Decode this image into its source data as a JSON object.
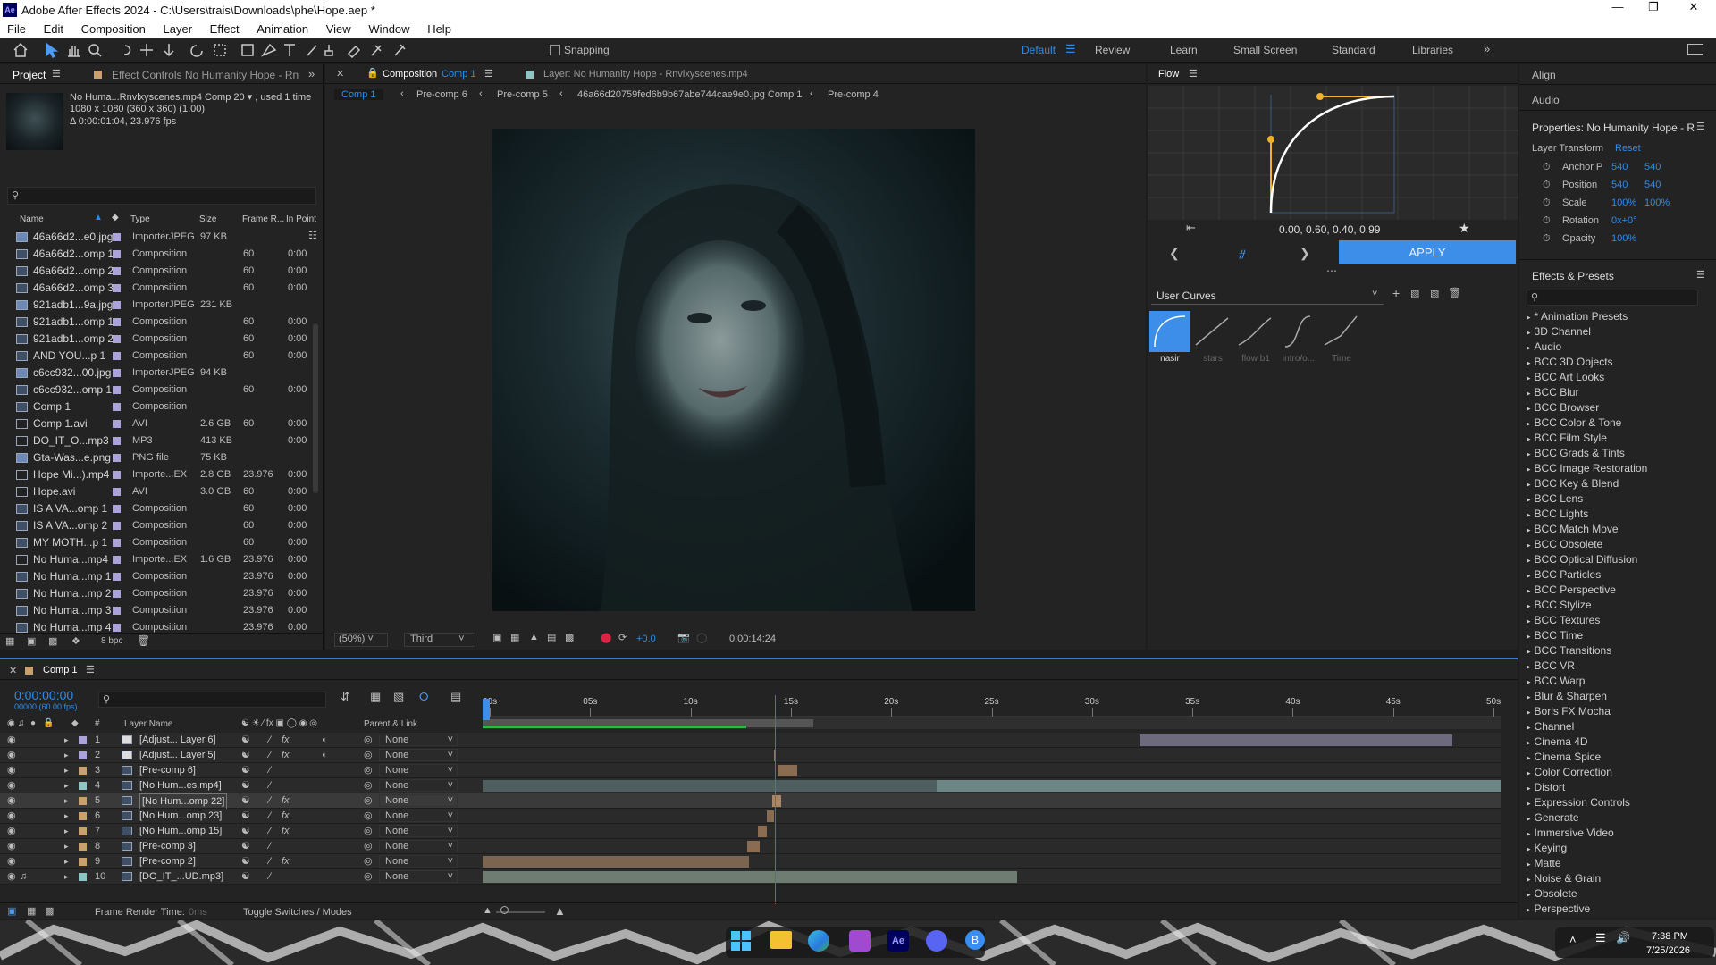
{
  "window": {
    "title": "Adobe After Effects 2024 - C:\\Users\\trais\\Downloads\\phe\\Hope.aep *",
    "app_badge": "Ae"
  },
  "menu": [
    "File",
    "Edit",
    "Composition",
    "Layer",
    "Effect",
    "Animation",
    "View",
    "Window",
    "Help"
  ],
  "toolbar": {
    "snapping_label": "Snapping",
    "workspaces": [
      "Default",
      "Review",
      "Learn",
      "Small Screen",
      "Standard",
      "Libraries"
    ],
    "active_workspace": "Default"
  },
  "project_panel": {
    "tab_project": "Project",
    "tab_effect_controls": "Effect Controls No Humanity Hope - Rn",
    "info_line1": "No Huma...Rnvlxyscenes.mp4 Comp 20 ▾ , used 1 time",
    "info_line2": "1080 x 1080  (360 x 360) (1.00)",
    "info_line3": "Δ 0:00:01:04, 23.976 fps",
    "search_placeholder": "",
    "columns": [
      "Name",
      "Type",
      "Size",
      "Frame R...",
      "In Point"
    ],
    "items": [
      {
        "name": "46a66d2...e0.jpg",
        "type": "ImporterJPEG",
        "size": "97 KB",
        "rate": "",
        "inpt": "",
        "color": "#a9a3d9",
        "kind": "img"
      },
      {
        "name": "46a66d2...omp 1",
        "type": "Composition",
        "size": "",
        "rate": "60",
        "inpt": "0:00",
        "color": "#a9a3d9",
        "kind": "comp"
      },
      {
        "name": "46a66d2...omp 2",
        "type": "Composition",
        "size": "",
        "rate": "60",
        "inpt": "0:00",
        "color": "#a9a3d9",
        "kind": "comp"
      },
      {
        "name": "46a66d2...omp 3",
        "type": "Composition",
        "size": "",
        "rate": "60",
        "inpt": "0:00",
        "color": "#a9a3d9",
        "kind": "comp"
      },
      {
        "name": "921adb1...9a.jpg",
        "type": "ImporterJPEG",
        "size": "231 KB",
        "rate": "",
        "inpt": "",
        "color": "#a9a3d9",
        "kind": "img"
      },
      {
        "name": "921adb1...omp 1",
        "type": "Composition",
        "size": "",
        "rate": "60",
        "inpt": "0:00",
        "color": "#a9a3d9",
        "kind": "comp"
      },
      {
        "name": "921adb1...omp 2",
        "type": "Composition",
        "size": "",
        "rate": "60",
        "inpt": "0:00",
        "color": "#a9a3d9",
        "kind": "comp"
      },
      {
        "name": "AND YOU...p 1",
        "type": "Composition",
        "size": "",
        "rate": "60",
        "inpt": "0:00",
        "color": "#a9a3d9",
        "kind": "comp"
      },
      {
        "name": "c6cc932...00.jpg",
        "type": "ImporterJPEG",
        "size": "94 KB",
        "rate": "",
        "inpt": "",
        "color": "#a9a3d9",
        "kind": "img"
      },
      {
        "name": "c6cc932...omp 1",
        "type": "Composition",
        "size": "",
        "rate": "60",
        "inpt": "0:00",
        "color": "#a9a3d9",
        "kind": "comp"
      },
      {
        "name": "Comp 1",
        "type": "Composition",
        "size": "",
        "rate": "",
        "inpt": "",
        "color": "#a9a3d9",
        "kind": "comp"
      },
      {
        "name": "Comp 1.avi",
        "type": "AVI",
        "size": "2.6 GB",
        "rate": "60",
        "inpt": "0:00",
        "color": "#a9a3d9",
        "kind": "vid"
      },
      {
        "name": "DO_IT_O...mp3",
        "type": "MP3",
        "size": "413 KB",
        "rate": "",
        "inpt": "0:00",
        "color": "#a9a3d9",
        "kind": "vid"
      },
      {
        "name": "Gta-Was...e.png",
        "type": "PNG file",
        "size": "75 KB",
        "rate": "",
        "inpt": "",
        "color": "#a9a3d9",
        "kind": "img"
      },
      {
        "name": "Hope Mi...).mp4",
        "type": "Importe...EX",
        "size": "2.8 GB",
        "rate": "23.976",
        "inpt": "0:00",
        "color": "#a9a3d9",
        "kind": "vid"
      },
      {
        "name": "Hope.avi",
        "type": "AVI",
        "size": "3.0 GB",
        "rate": "60",
        "inpt": "0:00",
        "color": "#a9a3d9",
        "kind": "vid"
      },
      {
        "name": "IS A VA...omp 1",
        "type": "Composition",
        "size": "",
        "rate": "60",
        "inpt": "0:00",
        "color": "#a9a3d9",
        "kind": "comp"
      },
      {
        "name": "IS A VA...omp 2",
        "type": "Composition",
        "size": "",
        "rate": "60",
        "inpt": "0:00",
        "color": "#a9a3d9",
        "kind": "comp"
      },
      {
        "name": "MY MOTH...p 1",
        "type": "Composition",
        "size": "",
        "rate": "60",
        "inpt": "0:00",
        "color": "#a9a3d9",
        "kind": "comp"
      },
      {
        "name": "No Huma...mp4",
        "type": "Importe...EX",
        "size": "1.6 GB",
        "rate": "23.976",
        "inpt": "0:00",
        "color": "#a9a3d9",
        "kind": "vid"
      },
      {
        "name": "No Huma...mp 1",
        "type": "Composition",
        "size": "",
        "rate": "23.976",
        "inpt": "0:00",
        "color": "#a9a3d9",
        "kind": "comp"
      },
      {
        "name": "No Huma...mp 2",
        "type": "Composition",
        "size": "",
        "rate": "23.976",
        "inpt": "0:00",
        "color": "#a9a3d9",
        "kind": "comp"
      },
      {
        "name": "No Huma...mp 3",
        "type": "Composition",
        "size": "",
        "rate": "23.976",
        "inpt": "0:00",
        "color": "#a9a3d9",
        "kind": "comp"
      },
      {
        "name": "No Huma...mp 4",
        "type": "Composition",
        "size": "",
        "rate": "23.976",
        "inpt": "0:00",
        "color": "#a9a3d9",
        "kind": "comp"
      }
    ],
    "bpc": "8 bpc"
  },
  "composition": {
    "tab_comp_prefix": "Composition",
    "tab_comp_name": "Comp 1",
    "tab_layer": "Layer: No Humanity Hope - Rnvlxyscenes.mp4",
    "breadcrumbs": [
      "Comp 1",
      "Pre-comp 6",
      "Pre-comp 5",
      "46a66d20759fed6b9b67abe744cae9e0.jpg Comp 1",
      "Pre-comp 4"
    ],
    "zoom": "(50%)",
    "resolution": "Third",
    "exposure": "+0.0",
    "timecode": "0:00:14:24"
  },
  "flow": {
    "title": "Flow",
    "curve_values": "0.00, 0.60, 0.40, 0.99",
    "apply": "APPLY",
    "user_curves": "User Curves",
    "presets": [
      "nasir",
      "stars",
      "flow b1",
      "intro/o...",
      "Time"
    ]
  },
  "right_panel": {
    "align": "Align",
    "audio": "Audio",
    "properties_title": "Properties: No Humanity Hope - R",
    "layer_transform": "Layer Transform",
    "reset": "Reset",
    "props": [
      {
        "label": "Anchor P",
        "v1": "540",
        "v2": "540"
      },
      {
        "label": "Position",
        "v1": "540",
        "v2": "540"
      },
      {
        "label": "Scale",
        "v1": "100%",
        "v2": "100%"
      },
      {
        "label": "Rotation",
        "v1": "0x+0°",
        "v2": ""
      },
      {
        "label": "Opacity",
        "v1": "100%",
        "v2": ""
      }
    ],
    "effects_title": "Effects & Presets",
    "effects": [
      "* Animation Presets",
      "3D Channel",
      "Audio",
      "BCC 3D Objects",
      "BCC Art Looks",
      "BCC Blur",
      "BCC Browser",
      "BCC Color & Tone",
      "BCC Film Style",
      "BCC Grads & Tints",
      "BCC Image Restoration",
      "BCC Key & Blend",
      "BCC Lens",
      "BCC Lights",
      "BCC Match Move",
      "BCC Obsolete",
      "BCC Optical Diffusion",
      "BCC Particles",
      "BCC Perspective",
      "BCC Stylize",
      "BCC Textures",
      "BCC Time",
      "BCC Transitions",
      "BCC VR",
      "BCC Warp",
      "Blur & Sharpen",
      "Boris FX Mocha",
      "Channel",
      "Cinema 4D",
      "Cinema Spice",
      "Color Correction",
      "Distort",
      "Expression Controls",
      "Generate",
      "Immersive Video",
      "Keying",
      "Matte",
      "Noise & Grain",
      "Obsolete",
      "Perspective"
    ]
  },
  "timeline": {
    "tab": "Comp 1",
    "timecode": "0:00:00:00",
    "frames": "00000 (60.00 fps)",
    "col_layer_name": "Layer Name",
    "col_parent": "Parent & Link",
    "ruler": [
      "00s",
      "05s",
      "10s",
      "15s",
      "20s",
      "25s",
      "30s",
      "35s",
      "40s",
      "45s",
      "50s"
    ],
    "layers": [
      {
        "num": "1",
        "name": "[Adjust... Layer 6]",
        "color": "#a9a3d9",
        "parent": "None",
        "fx": true
      },
      {
        "num": "2",
        "name": "[Adjust... Layer 5]",
        "color": "#a9a3d9",
        "parent": "None",
        "fx": true
      },
      {
        "num": "3",
        "name": "[Pre-comp 6]",
        "color": "#c8a16e",
        "parent": "None",
        "fx": false
      },
      {
        "num": "4",
        "name": "[No Hum...es.mp4]",
        "color": "#8fc4c4",
        "parent": "None",
        "fx": false
      },
      {
        "num": "5",
        "name": "[No Hum...omp 22]",
        "color": "#c8a16e",
        "parent": "None",
        "fx": true
      },
      {
        "num": "6",
        "name": "[No Hum...omp 23]",
        "color": "#c8a16e",
        "parent": "None",
        "fx": true
      },
      {
        "num": "7",
        "name": "[No Hum...omp 15]",
        "color": "#c8a16e",
        "parent": "None",
        "fx": true
      },
      {
        "num": "8",
        "name": "[Pre-comp 3]",
        "color": "#c8a16e",
        "parent": "None",
        "fx": false
      },
      {
        "num": "9",
        "name": "[Pre-comp 2]",
        "color": "#c8a16e",
        "parent": "None",
        "fx": true
      },
      {
        "num": "10",
        "name": "[DO_IT_...UD.mp3]",
        "color": "#8fc4c4",
        "parent": "None",
        "fx": false
      }
    ],
    "frame_render": "Frame Render Time:",
    "frame_render_value": "0ms",
    "toggle": "Toggle Switches / Modes"
  },
  "taskbar": {
    "time": "7:38 PM",
    "date": "7/25/2026"
  }
}
